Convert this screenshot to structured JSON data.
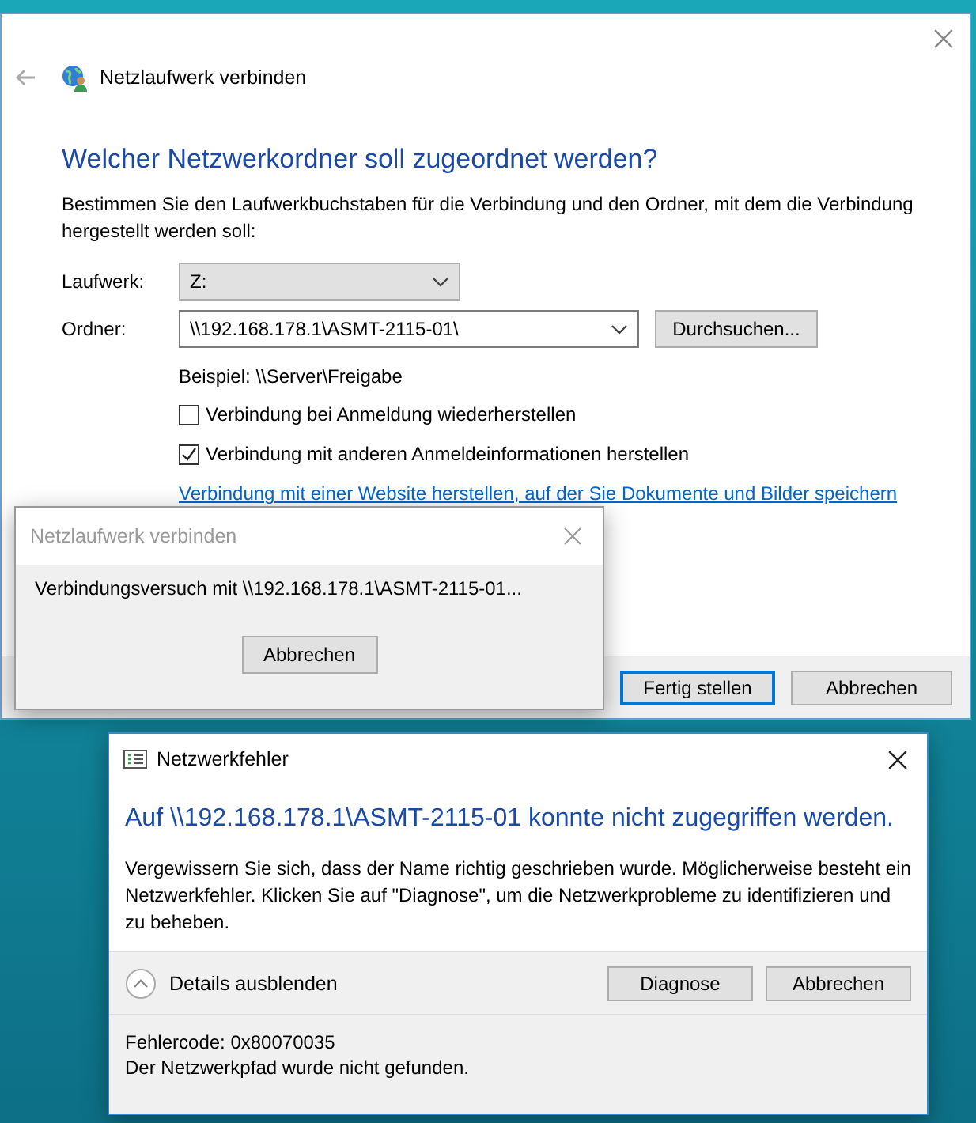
{
  "main_window": {
    "title": "Netzlaufwerk verbinden",
    "heading": "Welcher Netzwerkordner soll zugeordnet werden?",
    "description": "Bestimmen Sie den Laufwerkbuchstaben für die Verbindung und den Ordner, mit dem die Verbindung hergestellt werden soll:",
    "fields": [
      {
        "label": "Laufwerk:",
        "value": "Z:",
        "kind": "dropdown"
      },
      {
        "label": "Ordner:",
        "value": "\\\\192.168.178.1\\ASMT-2115-01\\",
        "kind": "combo",
        "button": "Durchsuchen..."
      }
    ],
    "example": "Beispiel: \\\\Server\\Freigabe",
    "checkboxes": [
      {
        "label": "Verbindung bei Anmeldung wiederherstellen",
        "checked": false
      },
      {
        "label": "Verbindung mit anderen Anmeldeinformationen herstellen",
        "checked": true
      }
    ],
    "link": "Verbindung mit einer Website herstellen, auf der Sie Dokumente und Bilder speichern",
    "buttons": [
      {
        "label": "Fertig stellen",
        "default": true
      },
      {
        "label": "Abbrechen",
        "default": false
      }
    ]
  },
  "progress_dialog": {
    "title": "Netzlaufwerk verbinden",
    "message": "Verbindungsversuch mit \\\\192.168.178.1\\ASMT-2115-01...",
    "button": "Abbrechen"
  },
  "error_dialog": {
    "title": "Netzwerkfehler",
    "heading": "Auf \\\\192.168.178.1\\ASMT-2115-01 konnte nicht zugegriffen werden.",
    "message": "Vergewissern Sie sich, dass der Name richtig geschrieben wurde. Möglicherweise besteht ein Netzwerkfehler. Klicken Sie auf \"Diagnose\", um die Netzwerkprobleme zu identifizieren und zu beheben.",
    "details_toggle": {
      "label": "Details ausblenden",
      "expanded": true
    },
    "buttons": [
      "Diagnose",
      "Abbrechen"
    ],
    "details": [
      "Fehlercode: 0x80070035",
      "Der Netzwerkpfad wurde nicht gefunden."
    ]
  }
}
